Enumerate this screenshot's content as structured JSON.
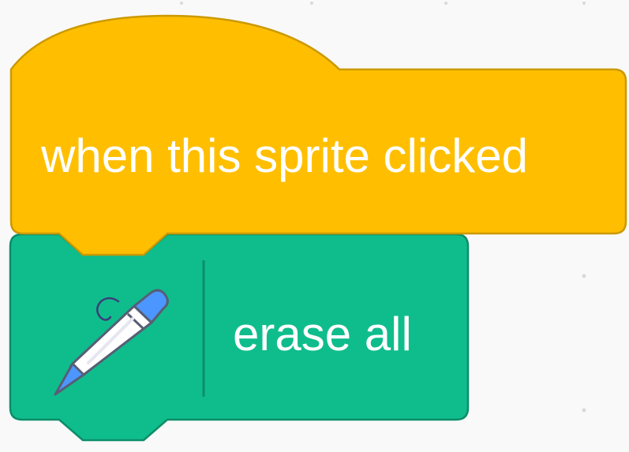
{
  "workspace": {
    "background_color": "#f9f9f9",
    "grid_dot_color": "#d9d9d9"
  },
  "hat_block": {
    "category": "events",
    "label": "when this sprite clicked",
    "fill_color": "#ffbf00",
    "stroke_color": "#cc9900"
  },
  "pen_block": {
    "category": "pen",
    "label": "erase all",
    "icon": "pen-icon",
    "fill_color": "#0fbd8c",
    "stroke_color": "#0b8e69",
    "separator_color": "#0b8e69"
  }
}
